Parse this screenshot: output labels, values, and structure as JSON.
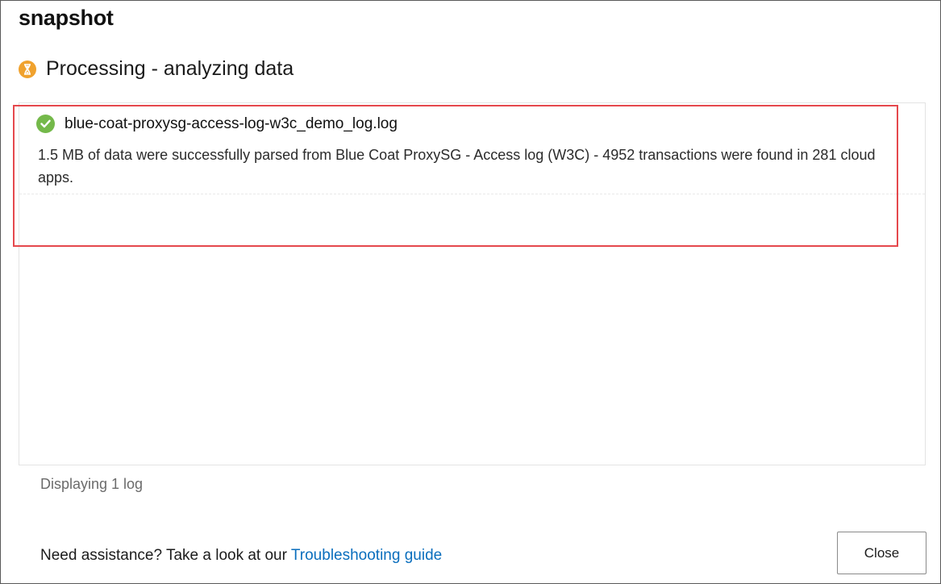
{
  "dialog": {
    "title": "snapshot"
  },
  "status": {
    "text": "Processing - analyzing data",
    "icon": "hourglass-icon",
    "icon_color": "#f0a22e"
  },
  "logs": [
    {
      "name": "blue-coat-proxysg-access-log-w3c_demo_log.log",
      "description": "1.5 MB of data were successfully parsed from Blue Coat ProxySG - Access log (W3C) - 4952 transactions were found in 281 cloud apps.",
      "icon": "success-check-icon",
      "icon_color": "#74b94a"
    }
  ],
  "footer": {
    "count_text": "Displaying 1 log",
    "help_text": "Need assistance? Take a look at our ",
    "help_link": "Troubleshooting guide",
    "close_label": "Close"
  },
  "colors": {
    "highlight": "#e5484d",
    "link": "#0a6ebd"
  }
}
